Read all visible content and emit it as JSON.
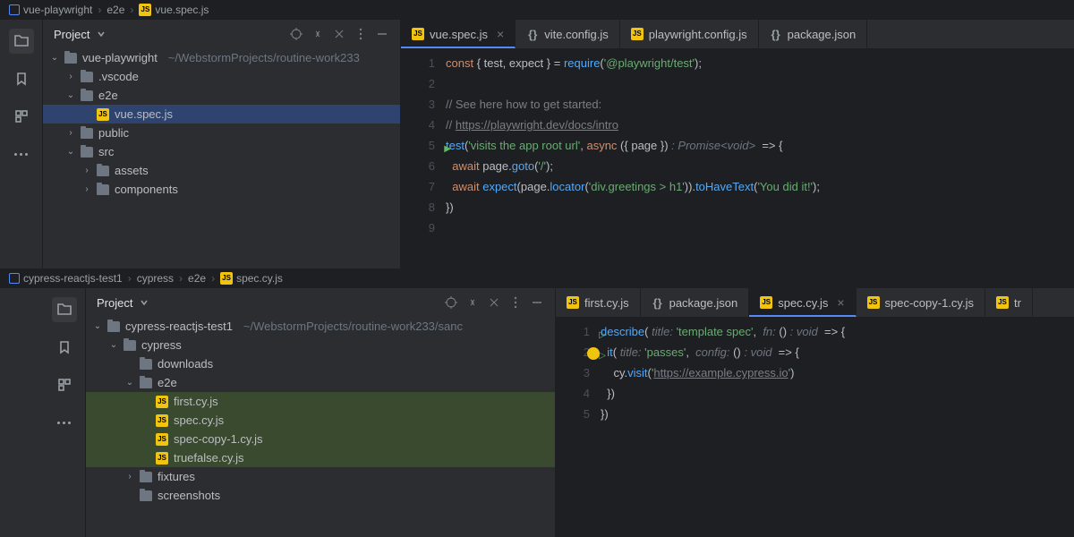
{
  "pane1": {
    "breadcrumb": [
      {
        "icon": "proj",
        "label": "vue-playwright"
      },
      {
        "label": "e2e"
      },
      {
        "icon": "js",
        "label": "vue.spec.js"
      }
    ],
    "panelTitle": "Project",
    "tree": [
      {
        "depth": 0,
        "arrow": "v",
        "icon": "folder",
        "label": "vue-playwright",
        "muted": "~/WebstormProjects/routine-work233"
      },
      {
        "depth": 1,
        "arrow": ">",
        "icon": "folder",
        "label": ".vscode"
      },
      {
        "depth": 1,
        "arrow": "v",
        "icon": "folder",
        "label": "e2e"
      },
      {
        "depth": 2,
        "arrow": "",
        "icon": "js",
        "label": "vue.spec.js",
        "sel": "sel"
      },
      {
        "depth": 1,
        "arrow": ">",
        "icon": "folder",
        "label": "public"
      },
      {
        "depth": 1,
        "arrow": "v",
        "icon": "folder",
        "label": "src"
      },
      {
        "depth": 2,
        "arrow": ">",
        "icon": "folder",
        "label": "assets"
      },
      {
        "depth": 2,
        "arrow": ">",
        "icon": "folder",
        "label": "components"
      }
    ],
    "tabs": [
      {
        "icon": "js",
        "label": "vue.spec.js",
        "active": true,
        "closable": true
      },
      {
        "icon": "json",
        "label": "vite.config.js"
      },
      {
        "icon": "js",
        "label": "playwright.config.js"
      },
      {
        "icon": "json",
        "label": "package.json"
      }
    ],
    "code": [
      {
        "n": 1,
        "html": "<span class='kw'>const</span> { <span class='param'>test</span>, <span class='param'>expect</span> } = <span class='fn'>require</span>(<span class='str'>'@playwright/test'</span>);"
      },
      {
        "n": 2,
        "html": ""
      },
      {
        "n": 3,
        "html": "<span class='cmt'>// See here how to get started:</span>"
      },
      {
        "n": 4,
        "html": "<span class='cmt'>// </span><span class='link'>https://playwright.dev/docs/intro</span>"
      },
      {
        "n": 5,
        "html": "<span class='fn'>test</span>(<span class='str'>'visits the app root url'</span>, <span class='kw'>async</span> ({ <span class='param'>page</span> }) <span class='hint'>: Promise&lt;void&gt;</span>  =&gt; {",
        "run": true
      },
      {
        "n": 6,
        "html": "  <span class='kw'>await</span> <span class='param'>page</span>.<span class='fn'>goto</span>(<span class='str'>'/'</span>);"
      },
      {
        "n": 7,
        "html": "  <span class='kw'>await</span> <span class='fn'>expect</span>(<span class='param'>page</span>.<span class='fn'>locator</span>(<span class='str'>'div.greetings &gt; h1'</span>)).<span class='fn'>toHaveText</span>(<span class='str'>'You did it!'</span>);"
      },
      {
        "n": 8,
        "html": "})"
      },
      {
        "n": 9,
        "html": ""
      }
    ]
  },
  "pane2": {
    "breadcrumb": [
      {
        "icon": "proj",
        "label": "cypress-reactjs-test1"
      },
      {
        "label": "cypress"
      },
      {
        "label": "e2e"
      },
      {
        "icon": "js",
        "label": "spec.cy.js"
      }
    ],
    "panelTitle": "Project",
    "tree": [
      {
        "depth": 0,
        "arrow": "v",
        "icon": "folder",
        "label": "cypress-reactjs-test1",
        "muted": "~/WebstormProjects/routine-work233/sanc"
      },
      {
        "depth": 1,
        "arrow": "v",
        "icon": "folder",
        "label": "cypress"
      },
      {
        "depth": 2,
        "arrow": "",
        "icon": "folder",
        "label": "downloads"
      },
      {
        "depth": 2,
        "arrow": "v",
        "icon": "folder",
        "label": "e2e"
      },
      {
        "depth": 3,
        "arrow": "",
        "icon": "js",
        "label": "first.cy.js",
        "sel": "sel2"
      },
      {
        "depth": 3,
        "arrow": "",
        "icon": "js",
        "label": "spec.cy.js",
        "sel": "sel2"
      },
      {
        "depth": 3,
        "arrow": "",
        "icon": "js",
        "label": "spec-copy-1.cy.js",
        "sel": "sel2"
      },
      {
        "depth": 3,
        "arrow": "",
        "icon": "js",
        "label": "truefalse.cy.js",
        "sel": "sel2"
      },
      {
        "depth": 2,
        "arrow": ">",
        "icon": "folder",
        "label": "fixtures"
      },
      {
        "depth": 2,
        "arrow": "",
        "icon": "folder",
        "label": "screenshots"
      }
    ],
    "tabs": [
      {
        "icon": "js",
        "label": "first.cy.js"
      },
      {
        "icon": "json",
        "label": "package.json"
      },
      {
        "icon": "js",
        "label": "spec.cy.js",
        "active": true,
        "closable": true
      },
      {
        "icon": "js",
        "label": "spec-copy-1.cy.js"
      },
      {
        "icon": "js",
        "label": "tr"
      }
    ],
    "code": [
      {
        "n": 1,
        "html": "<span class='fn'>describe</span>( <span class='hint'>title:</span> <span class='str'>'template spec'</span>,  <span class='hint'>fn:</span> () <span class='hint'>: void</span>  =&gt; {",
        "run2": true
      },
      {
        "n": 2,
        "html": "  <span class='rel'><span class='bulb'></span></span><span class='fn'>it</span>( <span class='hint'>title:</span> <span class='str'>'passes'</span>,  <span class='hint'>config:</span> () <span class='hint'>: void</span>  =&gt; {",
        "run2": true
      },
      {
        "n": 3,
        "html": "    <span class='param'>cy</span>.<span class='fn'>visit</span>(<span class='str'>'<span class='link'>https://example.cypress.io</span>'</span>)"
      },
      {
        "n": 4,
        "html": "  })"
      },
      {
        "n": 5,
        "html": "})"
      }
    ]
  }
}
